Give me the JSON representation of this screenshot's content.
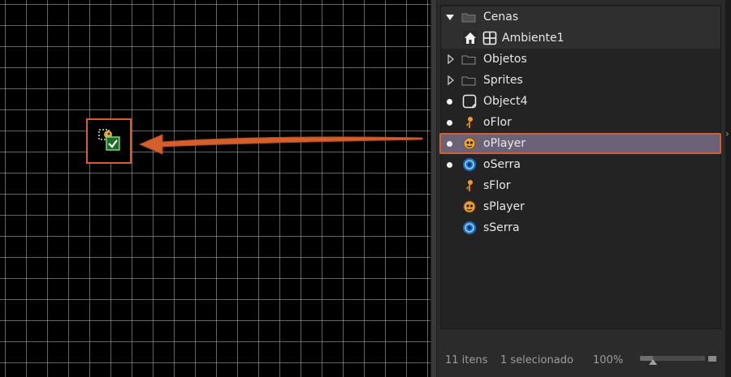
{
  "canvas": {
    "instance_name": "oPlayer"
  },
  "asset_tree": {
    "items": [
      {
        "label": "Cenas",
        "kind": "group",
        "expanded": true,
        "icon": "folder-icon"
      },
      {
        "label": "Ambiente1",
        "kind": "room",
        "icon": "room-icon"
      },
      {
        "label": "Objetos",
        "kind": "group",
        "expanded": false,
        "icon": "folder-icon"
      },
      {
        "label": "Sprites",
        "kind": "group",
        "expanded": false,
        "icon": "folder-icon"
      },
      {
        "label": "Object4",
        "kind": "object",
        "icon": "empty-object-icon"
      },
      {
        "label": "oFlor",
        "kind": "object",
        "icon": "flower-sprite-icon"
      },
      {
        "label": "oPlayer",
        "kind": "object",
        "icon": "player-sprite-icon",
        "selected": true
      },
      {
        "label": "oSerra",
        "kind": "object",
        "icon": "saw-sprite-icon"
      },
      {
        "label": "sFlor",
        "kind": "sprite",
        "icon": "flower-sprite-icon"
      },
      {
        "label": "sPlayer",
        "kind": "sprite",
        "icon": "player-sprite-icon"
      },
      {
        "label": "sSerra",
        "kind": "sprite",
        "icon": "saw-sprite-icon"
      }
    ]
  },
  "statusbar": {
    "item_count": "11 itens",
    "selection": "1 selecionado",
    "zoom": "100%",
    "zoom_fraction": 0.2
  },
  "colors": {
    "highlight_orange": "#d45f2c",
    "selected_row": "#6b6278",
    "panel_bg": "#232323"
  }
}
